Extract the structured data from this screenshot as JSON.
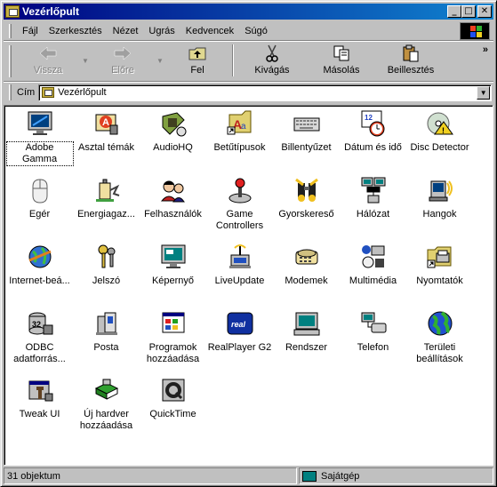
{
  "window": {
    "title": "Vezérlőpult"
  },
  "menu": [
    "Fájl",
    "Szerkesztés",
    "Nézet",
    "Ugrás",
    "Kedvencek",
    "Súgó"
  ],
  "toolbar": {
    "back": "Vissza",
    "forward": "Előre",
    "up": "Fel",
    "cut": "Kivágás",
    "copy": "Másolás",
    "paste": "Beillesztés"
  },
  "address": {
    "label": "Cím",
    "value": "Vezérlőpult"
  },
  "items": [
    {
      "label": "Adobe Gamma",
      "icon": "monitor-gamma-icon"
    },
    {
      "label": "Asztal témák",
      "icon": "desktop-themes-icon"
    },
    {
      "label": "AudioHQ",
      "icon": "audiohq-icon"
    },
    {
      "label": "Betűtípusok",
      "icon": "fonts-icon"
    },
    {
      "label": "Billentyűzet",
      "icon": "keyboard-icon"
    },
    {
      "label": "Dátum és idő",
      "icon": "date-time-icon"
    },
    {
      "label": "Disc Detector",
      "icon": "disc-detector-icon"
    },
    {
      "label": "Egér",
      "icon": "mouse-icon"
    },
    {
      "label": "Energiagaz...",
      "icon": "power-management-icon"
    },
    {
      "label": "Felhasználók",
      "icon": "users-icon"
    },
    {
      "label": "Game Controllers",
      "icon": "joystick-icon"
    },
    {
      "label": "Gyorskereső",
      "icon": "binoculars-icon"
    },
    {
      "label": "Hálózat",
      "icon": "network-icon"
    },
    {
      "label": "Hangok",
      "icon": "sounds-icon"
    },
    {
      "label": "Internet-beá...",
      "icon": "internet-settings-icon"
    },
    {
      "label": "Jelszó",
      "icon": "keys-icon"
    },
    {
      "label": "Képernyő",
      "icon": "display-icon"
    },
    {
      "label": "LiveUpdate",
      "icon": "liveupdate-icon"
    },
    {
      "label": "Modemek",
      "icon": "modem-icon"
    },
    {
      "label": "Multimédia",
      "icon": "multimedia-icon"
    },
    {
      "label": "Nyomtatók",
      "icon": "printers-folder-icon"
    },
    {
      "label": "ODBC adatforrás...",
      "icon": "odbc-icon"
    },
    {
      "label": "Posta",
      "icon": "mail-icon"
    },
    {
      "label": "Programok hozzáadása",
      "icon": "add-programs-icon"
    },
    {
      "label": "RealPlayer G2",
      "icon": "realplayer-icon"
    },
    {
      "label": "Rendszer",
      "icon": "system-icon"
    },
    {
      "label": "Telefon",
      "icon": "telephony-icon"
    },
    {
      "label": "Területi beállítások",
      "icon": "globe-icon"
    },
    {
      "label": "Tweak UI",
      "icon": "tweakui-icon"
    },
    {
      "label": "Új hardver hozzáadása",
      "icon": "add-hardware-icon"
    },
    {
      "label": "QuickTime",
      "icon": "quicktime-icon"
    }
  ],
  "status": {
    "count": "31 objektum",
    "location": "Sajátgép"
  }
}
